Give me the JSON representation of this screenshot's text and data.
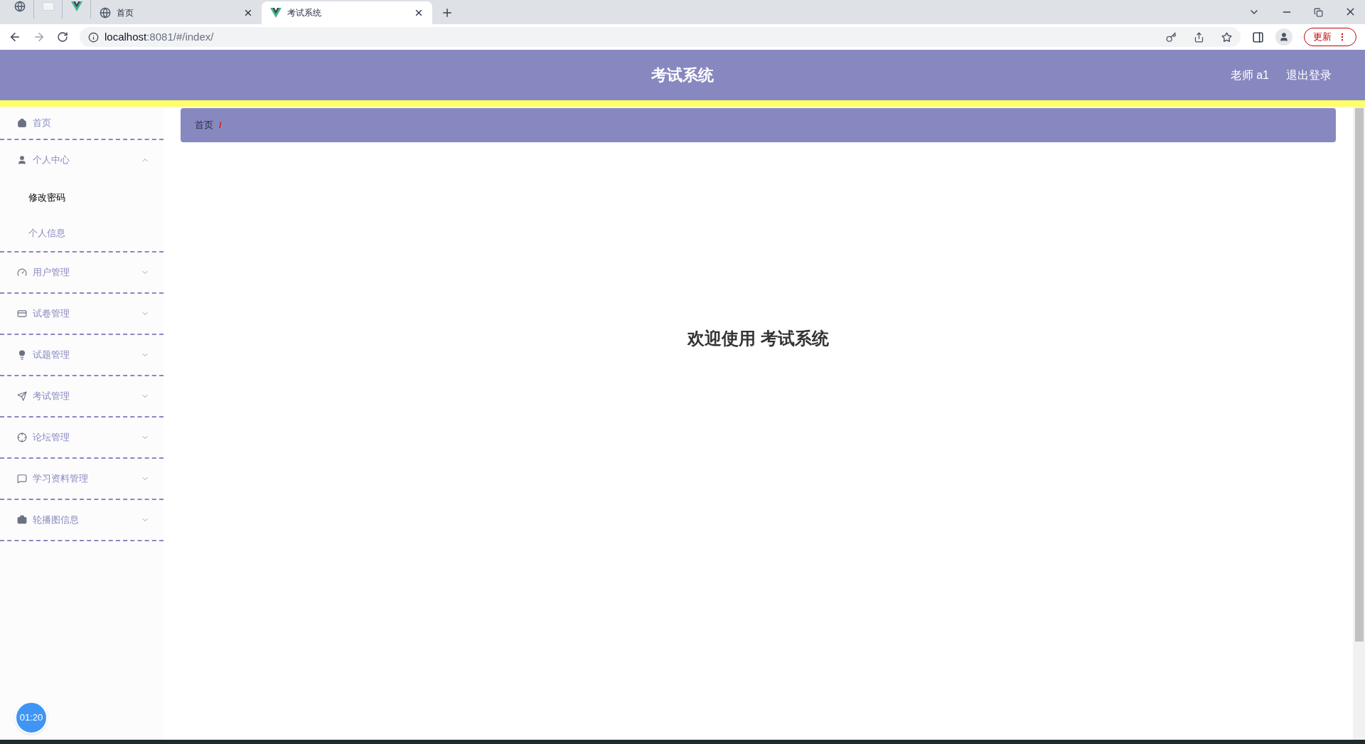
{
  "browser": {
    "tabs": [
      {
        "kind": "pinned",
        "selected": false
      },
      {
        "kind": "pinned",
        "selected": false
      },
      {
        "kind": "pinned",
        "selected": false
      },
      {
        "kind": "tab",
        "title": "首页",
        "selected": false
      },
      {
        "kind": "tab",
        "title": "考试系统",
        "selected": true
      }
    ],
    "address": {
      "host": "localhost",
      "rest": ":8081/#/index/"
    },
    "update_button": "更新"
  },
  "header": {
    "title": "考试系统",
    "user": "老师 a1",
    "logout": "退出登录"
  },
  "sidebar": {
    "items": [
      {
        "kind": "link",
        "label": "首页"
      },
      {
        "kind": "submenu",
        "label": "个人中心",
        "expanded": true,
        "children": [
          {
            "label": "修改密码",
            "selected": true
          },
          {
            "label": "个人信息",
            "selected": false
          }
        ]
      },
      {
        "kind": "submenu",
        "label": "用户管理",
        "expanded": false
      },
      {
        "kind": "submenu",
        "label": "试卷管理",
        "expanded": false
      },
      {
        "kind": "submenu",
        "label": "试题管理",
        "expanded": false
      },
      {
        "kind": "submenu",
        "label": "考试管理",
        "expanded": false
      },
      {
        "kind": "submenu",
        "label": "论坛管理",
        "expanded": false
      },
      {
        "kind": "submenu",
        "label": "学习资料管理",
        "expanded": false
      },
      {
        "kind": "submenu",
        "label": "轮播图信息",
        "expanded": false
      }
    ]
  },
  "breadcrumb": {
    "items": [
      "首页"
    ],
    "separator": "/"
  },
  "welcome": "欢迎使用 考试系统",
  "timer": "01:20"
}
